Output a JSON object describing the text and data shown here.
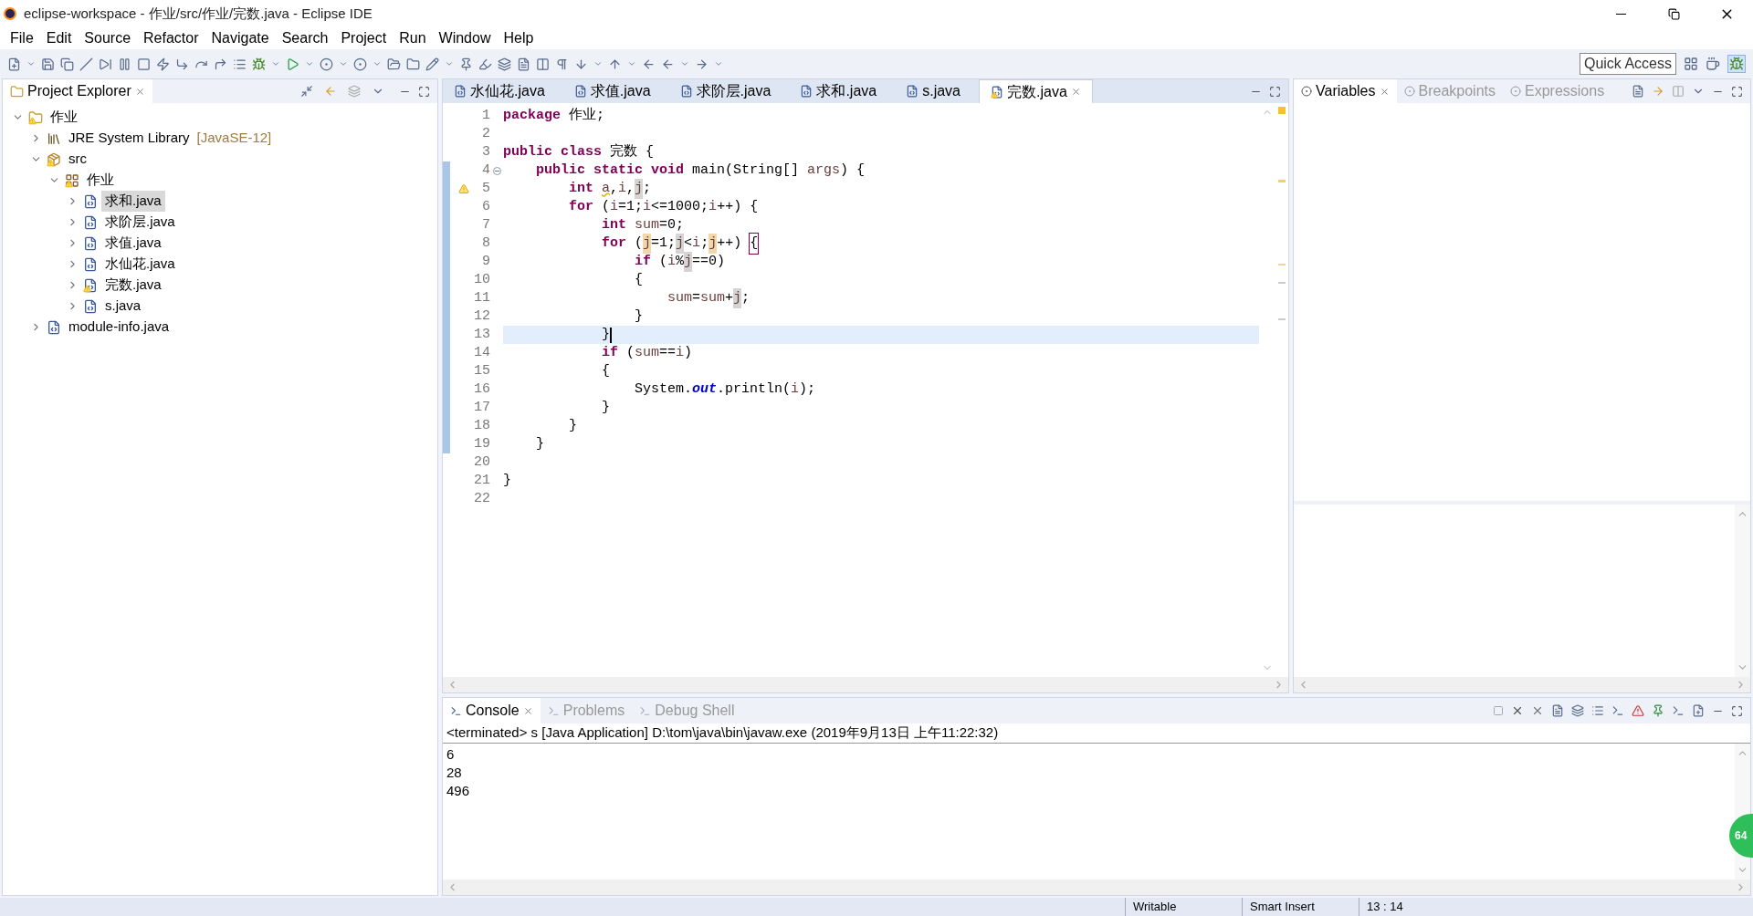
{
  "window": {
    "title": "eclipse-workspace - 作业/src/作业/完数.java - Eclipse IDE"
  },
  "menu": [
    "File",
    "Edit",
    "Source",
    "Refactor",
    "Navigate",
    "Search",
    "Project",
    "Run",
    "Window",
    "Help"
  ],
  "quick_access": "Quick Access",
  "project_explorer": {
    "title": "Project Explorer",
    "tree": [
      {
        "label": "作业",
        "kind": "project",
        "warning": true,
        "expanded": true,
        "selected": false,
        "children": [
          {
            "label": "JRE System Library",
            "suffix": "[JavaSE-12]",
            "kind": "library",
            "warning": false,
            "expanded": false,
            "selected": false
          },
          {
            "label": "src",
            "kind": "source-folder",
            "warning": true,
            "expanded": true,
            "selected": false,
            "children": [
              {
                "label": "作业",
                "kind": "package",
                "warning": true,
                "expanded": true,
                "selected": false,
                "children": [
                  {
                    "label": "求和.java",
                    "kind": "java-file",
                    "warning": false,
                    "expanded": false,
                    "selected": true
                  },
                  {
                    "label": "求阶层.java",
                    "kind": "java-file",
                    "warning": false,
                    "expanded": false,
                    "selected": false
                  },
                  {
                    "label": "求值.java",
                    "kind": "java-file",
                    "warning": false,
                    "expanded": false,
                    "selected": false
                  },
                  {
                    "label": "水仙花.java",
                    "kind": "java-file",
                    "warning": false,
                    "expanded": false,
                    "selected": false
                  },
                  {
                    "label": "完数.java",
                    "kind": "java-file",
                    "warning": true,
                    "expanded": false,
                    "selected": false
                  },
                  {
                    "label": "s.java",
                    "kind": "java-file",
                    "warning": false,
                    "expanded": false,
                    "selected": false
                  }
                ]
              }
            ]
          },
          {
            "label": "module-info.java",
            "kind": "java-file",
            "warning": false,
            "expanded": false,
            "selected": false
          }
        ]
      }
    ]
  },
  "editor": {
    "tabs": [
      {
        "label": "水仙花.java",
        "selected": false,
        "warning": false
      },
      {
        "label": "求值.java",
        "selected": false,
        "warning": false
      },
      {
        "label": "求阶层.java",
        "selected": false,
        "warning": false
      },
      {
        "label": "求和.java",
        "selected": false,
        "warning": false
      },
      {
        "label": "s.java",
        "selected": false,
        "warning": false
      },
      {
        "label": "完数.java",
        "selected": true,
        "warning": true
      }
    ],
    "lines": [
      {
        "number": "1",
        "current": false,
        "fold": false,
        "warning": false,
        "segments": [
          {
            "kind": "keyword",
            "text": "package"
          },
          {
            "kind": "text",
            "text": " 作业;"
          }
        ]
      },
      {
        "number": "2",
        "current": false,
        "fold": false,
        "warning": false
      },
      {
        "number": "3",
        "current": false,
        "fold": false,
        "warning": false,
        "segments": [
          {
            "kind": "keyword",
            "text": "public class"
          },
          {
            "kind": "text",
            "text": " 完数 {"
          }
        ]
      },
      {
        "number": "4",
        "current": false,
        "fold": true,
        "warning": false,
        "segments": [
          {
            "kind": "keyword",
            "text": "    public static void"
          },
          {
            "kind": "text",
            "text": " main(String[] "
          },
          {
            "kind": "local",
            "text": "args"
          },
          {
            "kind": "text",
            "text": ") {"
          }
        ]
      },
      {
        "number": "5",
        "current": false,
        "fold": false,
        "warning": true,
        "segments": [
          {
            "kind": "keyword",
            "text": "        int "
          },
          {
            "kind": "unused",
            "text": "a"
          },
          {
            "kind": "text",
            "text": ","
          },
          {
            "kind": "local",
            "text": "i"
          },
          {
            "kind": "text",
            "text": ","
          },
          {
            "kind": "occurrence",
            "text": "j"
          },
          {
            "kind": "text",
            "text": ";"
          }
        ]
      },
      {
        "number": "6",
        "current": false,
        "fold": false,
        "warning": false,
        "segments": [
          {
            "kind": "keyword",
            "text": "        for"
          },
          {
            "kind": "text",
            "text": " ("
          },
          {
            "kind": "local",
            "text": "i"
          },
          {
            "kind": "text",
            "text": "=1;"
          },
          {
            "kind": "local",
            "text": "i"
          },
          {
            "kind": "text",
            "text": "<=1000;"
          },
          {
            "kind": "local",
            "text": "i"
          },
          {
            "kind": "text",
            "text": "++) {"
          }
        ]
      },
      {
        "number": "7",
        "current": false,
        "fold": false,
        "warning": false,
        "segments": [
          {
            "kind": "keyword",
            "text": "            int "
          },
          {
            "kind": "local",
            "text": "sum"
          },
          {
            "kind": "text",
            "text": "=0;"
          }
        ]
      },
      {
        "number": "8",
        "current": false,
        "fold": false,
        "warning": false,
        "segments": [
          {
            "kind": "keyword",
            "text": "            for"
          },
          {
            "kind": "text",
            "text": " ("
          },
          {
            "kind": "write",
            "text": "j"
          },
          {
            "kind": "text",
            "text": "=1;"
          },
          {
            "kind": "occurrence",
            "text": "j"
          },
          {
            "kind": "text",
            "text": "<"
          },
          {
            "kind": "local",
            "text": "i"
          },
          {
            "kind": "text",
            "text": ";"
          },
          {
            "kind": "write",
            "text": "j"
          },
          {
            "kind": "text",
            "text": "++) "
          },
          {
            "kind": "bracket",
            "text": "{"
          }
        ]
      },
      {
        "number": "9",
        "current": false,
        "fold": false,
        "warning": false,
        "segments": [
          {
            "kind": "keyword",
            "text": "                if"
          },
          {
            "kind": "text",
            "text": " ("
          },
          {
            "kind": "local",
            "text": "i"
          },
          {
            "kind": "text",
            "text": "%"
          },
          {
            "kind": "occurrence",
            "text": "j"
          },
          {
            "kind": "text",
            "text": "==0)"
          }
        ]
      },
      {
        "number": "10",
        "current": false,
        "fold": false,
        "warning": false,
        "segments": [
          {
            "kind": "text",
            "text": "                {"
          }
        ]
      },
      {
        "number": "11",
        "current": false,
        "fold": false,
        "warning": false,
        "segments": [
          {
            "kind": "local",
            "text": "                    sum"
          },
          {
            "kind": "text",
            "text": "="
          },
          {
            "kind": "local",
            "text": "sum"
          },
          {
            "kind": "text",
            "text": "+"
          },
          {
            "kind": "occurrence",
            "text": "j"
          },
          {
            "kind": "text",
            "text": ";"
          }
        ]
      },
      {
        "number": "12",
        "current": false,
        "fold": false,
        "warning": false,
        "segments": [
          {
            "kind": "text",
            "text": "                }"
          }
        ]
      },
      {
        "number": "13",
        "current": true,
        "fold": false,
        "warning": false,
        "segments": [
          {
            "kind": "text",
            "text": "            }"
          }
        ]
      },
      {
        "number": "14",
        "current": false,
        "fold": false,
        "warning": false,
        "segments": [
          {
            "kind": "keyword",
            "text": "            if"
          },
          {
            "kind": "text",
            "text": " ("
          },
          {
            "kind": "local",
            "text": "sum"
          },
          {
            "kind": "text",
            "text": "=="
          },
          {
            "kind": "local",
            "text": "i"
          },
          {
            "kind": "text",
            "text": ")"
          }
        ]
      },
      {
        "number": "15",
        "current": false,
        "fold": false,
        "warning": false,
        "segments": [
          {
            "kind": "text",
            "text": "            {"
          }
        ]
      },
      {
        "number": "16",
        "current": false,
        "fold": false,
        "warning": false,
        "segments": [
          {
            "kind": "text",
            "text": "                System."
          },
          {
            "kind": "field",
            "text": "out"
          },
          {
            "kind": "text",
            "text": ".println("
          },
          {
            "kind": "local",
            "text": "i"
          },
          {
            "kind": "text",
            "text": ");"
          }
        ]
      },
      {
        "number": "17",
        "current": false,
        "fold": false,
        "warning": false,
        "segments": [
          {
            "kind": "text",
            "text": "            }"
          }
        ]
      },
      {
        "number": "18",
        "current": false,
        "fold": false,
        "warning": false,
        "segments": [
          {
            "kind": "text",
            "text": "        }"
          }
        ]
      },
      {
        "number": "19",
        "current": false,
        "fold": false,
        "warning": false,
        "segments": [
          {
            "kind": "text",
            "text": "    }"
          }
        ]
      },
      {
        "number": "20",
        "current": false,
        "fold": false,
        "warning": false
      },
      {
        "number": "21",
        "current": false,
        "fold": false,
        "warning": false,
        "segments": [
          {
            "kind": "text",
            "text": "}"
          }
        ]
      },
      {
        "number": "22",
        "current": false,
        "fold": false,
        "warning": false
      }
    ]
  },
  "debug_views": {
    "tabs": [
      {
        "label": "Variables",
        "selected": true
      },
      {
        "label": "Breakpoints",
        "selected": false
      },
      {
        "label": "Expressions",
        "selected": false
      }
    ]
  },
  "console": {
    "tabs": [
      {
        "label": "Console",
        "selected": true
      },
      {
        "label": "Problems",
        "selected": false
      },
      {
        "label": "Debug Shell",
        "selected": false
      }
    ],
    "header": "<terminated> s [Java Application] D:\\tom\\java\\bin\\javaw.exe (2019年9月13日 上午11:22:32)",
    "output": [
      "6",
      "28",
      "496"
    ]
  },
  "status_bar": [
    "Writable",
    "Smart Insert",
    "13 : 14"
  ],
  "floating_badge": "64"
}
